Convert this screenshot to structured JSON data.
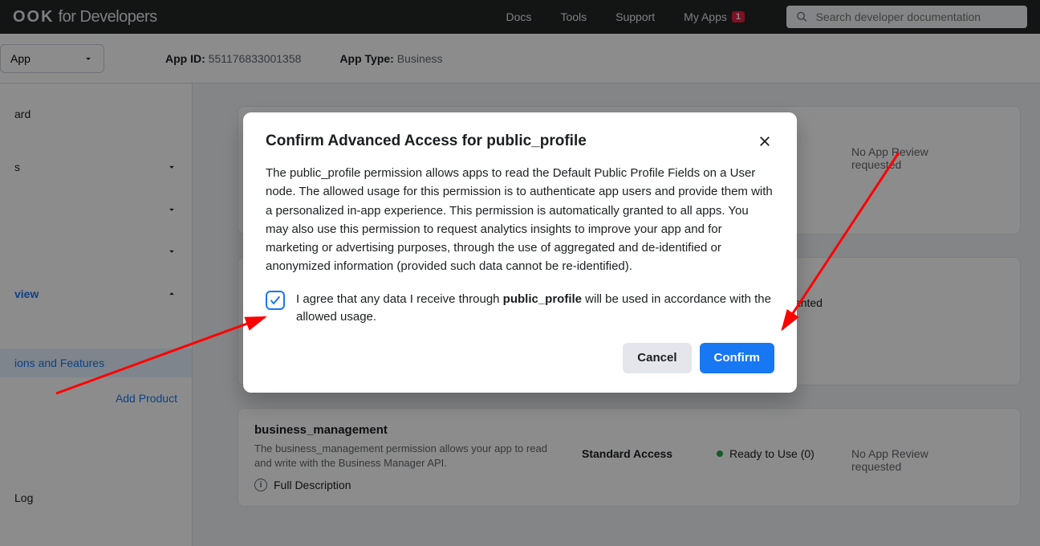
{
  "brand": {
    "line1": "OOK",
    "line2": "for Developers"
  },
  "topnav": {
    "docs": "Docs",
    "tools": "Tools",
    "support": "Support",
    "myapps": "My Apps",
    "myapps_badge": "1"
  },
  "search": {
    "placeholder": "Search developer documentation"
  },
  "app": {
    "selector": "App",
    "id_label": "App ID:",
    "id_value": "551176833001358",
    "type_label": "App Type:",
    "type_value": "Business"
  },
  "sidebar": {
    "dashboard": "ard",
    "settings": "s",
    "review": "view",
    "permissions": "ions and Features",
    "add_product": "Add Product",
    "log": "Log"
  },
  "dialog": {
    "title": "Confirm Advanced Access for public_profile",
    "body": "The public_profile permission allows apps to read the Default Public Profile Fields on a User node. The allowed usage for this permission is to authenticate app users and provide them with a personalized in-app experience. This permission is automatically granted to all apps. You may also use this permission to request analytics insights to improve your app and for marketing or advertising purposes, through the use of aggregated and de-identified or anonymized information (provided such data cannot be re-identified).",
    "agree_pre": "I agree that any data I receive through ",
    "agree_perm": "public_profile",
    "agree_post": " will be used in accordance with the allowed usage.",
    "cancel": "Cancel",
    "confirm": "Confirm"
  },
  "permissions": [
    {
      "name": "",
      "desc": "",
      "full": "",
      "access": "",
      "ready_count_suffix": ")",
      "status_dot": "grey",
      "status": "",
      "review": "No App Review requested"
    },
    {
      "name": "",
      "desc": "",
      "full": "",
      "access": "",
      "ready_count_suffix": ")",
      "status_dot": "green",
      "status": "Auto Granted",
      "review": ""
    },
    {
      "name": "business_management",
      "desc": "The business_management permission allows your app to read and write with the Business Manager API.",
      "full": "Full Description",
      "access": "Standard Access",
      "ready": "Ready to Use (0)",
      "status_dot": "green",
      "review": "No App Review requested"
    }
  ]
}
